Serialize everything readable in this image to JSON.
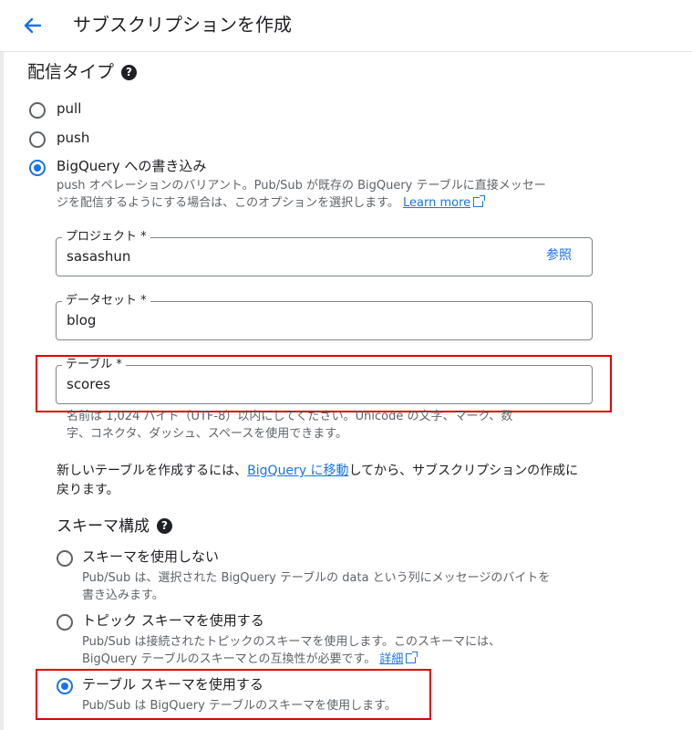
{
  "header": {
    "title": "サブスクリプションを作成"
  },
  "delivery_type": {
    "heading": "配信タイプ",
    "options": [
      {
        "label": "pull",
        "selected": false
      },
      {
        "label": "push",
        "selected": false
      },
      {
        "label": "BigQuery への書き込み",
        "selected": true
      }
    ],
    "bigquery_desc_line1": "push オペレーションのバリアント。Pub/Sub が既存の BigQuery テーブルに直接メッセー",
    "bigquery_desc_line2": "ジを配信するようにする場合は、このオプションを選択します。",
    "learn_more": "Learn more"
  },
  "fields": {
    "project": {
      "label": "プロジェクト *",
      "value": "sasashun",
      "browse": "参照"
    },
    "dataset": {
      "label": "データセット *",
      "value": "blog"
    },
    "table": {
      "label": "テーブル *",
      "value": "scores"
    },
    "table_hint_line1": "名前は 1,024 バイト（UTF-8）以内にしてください。Unicode の文字、マーク、数",
    "table_hint_line2": "字、コネクタ、ダッシュ、スペースを使用できます。"
  },
  "new_table_note": {
    "before": "新しいテーブルを作成するには、",
    "link": "BigQuery に移動",
    "after": "してから、サブスクリプションの作成に",
    "line2": "戻ります。"
  },
  "schema": {
    "heading": "スキーマ構成",
    "options": [
      {
        "label": "スキーマを使用しない",
        "desc1": "Pub/Sub は、選択された BigQuery テーブルの data という列にメッセージのバイトを",
        "desc2": "書き込みます。",
        "selected": false
      },
      {
        "label": "トピック スキーマを使用する",
        "desc1": "Pub/Sub は接続されたトピックのスキーマを使用します。このスキーマには、",
        "desc2": "BigQuery テーブルのスキーマとの互換性が必要です。",
        "link": "詳細",
        "selected": false
      },
      {
        "label": "テーブル スキーマを使用する",
        "desc1": "Pub/Sub は BigQuery テーブルのスキーマを使用します。",
        "selected": true
      }
    ]
  },
  "colors": {
    "accent": "#1a73e8",
    "highlight_box": "#e00000",
    "text_primary": "#202124",
    "text_secondary": "#5f6368"
  }
}
